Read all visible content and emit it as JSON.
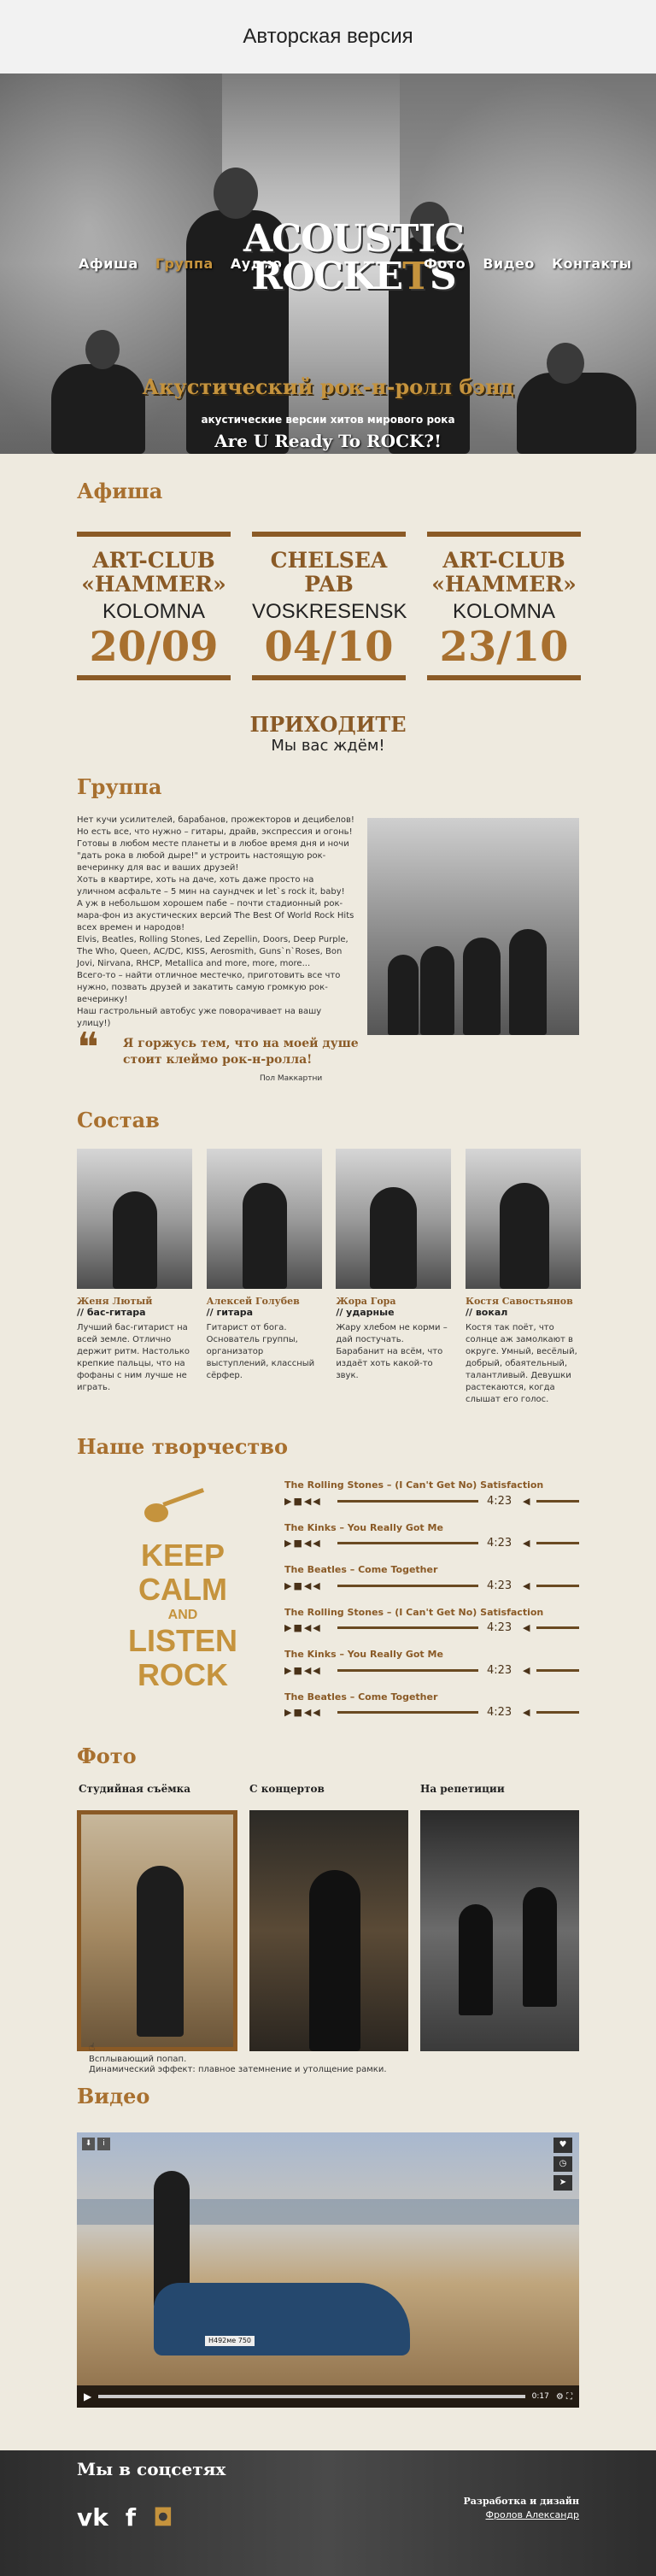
{
  "topbar": {
    "title": "Авторская версия"
  },
  "hero": {
    "logo_line1": "ACOUSTIC",
    "logo_line2a": "ROCKE",
    "logo_line2b": "T",
    "logo_line2c": "S",
    "nav_left": [
      "Афиша",
      "Группа",
      "Аудио"
    ],
    "nav_right": [
      "Фото",
      "Видео",
      "Контакты"
    ],
    "tagline": "Акустический рок-н-ролл бэнд",
    "subtitle": "акустические версии хитов мирового рока",
    "cta": "Are U Ready To ROCK?!"
  },
  "afisha": {
    "title": "Афиша",
    "events": [
      {
        "venue1": "ART-CLUB",
        "venue2": "«HAMMER»",
        "city": "KOLOMNA",
        "date": "20/09"
      },
      {
        "venue1": "CHELSEA",
        "venue2": "PAB",
        "city": "VOSKRESENSK",
        "date": "04/10"
      },
      {
        "venue1": "ART-CLUB",
        "venue2": "«HAMMER»",
        "city": "KOLOMNA",
        "date": "23/10"
      }
    ],
    "come_title": "ПРИХОДИТЕ",
    "come_sub": "Мы вас ждём!"
  },
  "group": {
    "title": "Группа",
    "paragraphs": [
      "Нет кучи усилителей, барабанов, прожекторов и децибелов! Но есть все, что нужно – гитары, драйв, экспрессия и огонь!",
      "Готовы в любом месте планеты и в любое время дня и ночи \"дать рока в любой дыре!\" и устроить настоящую рок-вечеринку для вас и ваших друзей!",
      "Хоть в квартире, хоть на даче, хоть даже просто на уличном асфальте – 5 мин на саундчек и let`s rock it, baby!",
      "А уж в небольшом хорошем пабе – почти стадионный рок-мара-фон из акустических версий The Best Of World Rock Hits всех времен и народов!",
      "Elvis, Beatles, Rolling Stones, Led Zepellin, Doors, Deep Purple, The Who, Queen, AC/DC, KISS, Aerosmith, Guns`n`Roses, Bon Jovi, Nirvana, RHCP, Metallica and more, more, more...",
      "Всего-то – найти отличное местечко, приготовить все что нужно, позвать друзей и закатить самую громкую рок-вечеринку!",
      "Наш гастрольный автобус уже поворачивает на вашу улицу!)"
    ],
    "quote": "Я горжусь тем, что на моей душе стоит клеймо рок-н-ролла!",
    "quote_author": "Пол Маккартни"
  },
  "members": {
    "title": "Состав",
    "list": [
      {
        "name": "Женя Лютый",
        "role": "// бас-гитара",
        "desc": "Лучший бас-гитарист на всей земле. Отлично держит ритм. Настолько крепкие пальцы, что на фофаны с ним лучше не играть."
      },
      {
        "name": "Алексей Голубев",
        "role": "// гитара",
        "desc": "Гитарист от бога. Основатель группы, организатор выступлений, классный сёрфер."
      },
      {
        "name": "Жора Гора",
        "role": "// ударные",
        "desc": "Жару хлебом не корми – дай постучать. Барабанит на всём, что издаёт хоть какой-то звук."
      },
      {
        "name": "Костя Савостьянов",
        "role": "// вокал",
        "desc": "Костя так поёт, что солнце аж замолкают в округе. Умный, весёлый, добрый, обаятельный, талантливый. Девушки растекаются, когда слышат его голос."
      }
    ]
  },
  "audio": {
    "title": "Наше творчество",
    "poster": [
      "KEEP",
      "CALM",
      "AND",
      "LISTEN",
      "ROCK"
    ],
    "tracks": [
      {
        "name": "The Rolling Stones – (I Can't Get No) Satisfaction",
        "time": "4:23"
      },
      {
        "name": "The Kinks – You Really Got Me",
        "time": "4:23"
      },
      {
        "name": "The Beatles – Come Together",
        "time": "4:23"
      },
      {
        "name": "The Rolling Stones – (I Can't Get No) Satisfaction",
        "time": "4:23"
      },
      {
        "name": "The Kinks – You Really Got Me",
        "time": "4:23"
      },
      {
        "name": "The Beatles – Come Together",
        "time": "4:23"
      }
    ]
  },
  "photo": {
    "title": "Фото",
    "albums": [
      "Студийная съёмка",
      "С концертов",
      "На репетиции"
    ],
    "caption1": "Всплывающий попап.",
    "caption2": "Динамический эффект: плавное затемнение и утолщение рамки."
  },
  "video": {
    "title": "Видео",
    "time": "0:17",
    "plate": "Н492ме 750"
  },
  "footer": {
    "social_title": "Мы в соцсетях",
    "dev_label": "Разработка и дизайн",
    "dev_author": "Фролов Александр"
  },
  "colors": {
    "accent": "#c5933d",
    "brown": "#8a5a26",
    "background": "#eeeadf"
  }
}
